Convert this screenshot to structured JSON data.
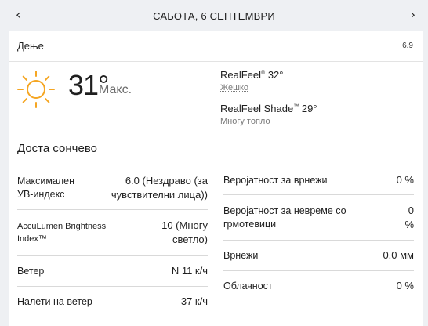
{
  "nav": {
    "prev_icon": "‹",
    "next_icon": "›",
    "date": "САБОТА, 6 СЕПТЕМВРИ"
  },
  "header": {
    "title": "Дење",
    "timestamp": "6.9"
  },
  "current": {
    "icon": "sun-icon",
    "temperature": "31°",
    "unit_label": "Макс.",
    "realfeel_label": "RealFeel",
    "realfeel_value": "32°",
    "realfeel_desc": "Жешко",
    "realfeel_shade_label": "RealFeel Shade",
    "realfeel_shade_value": "29°",
    "realfeel_shade_desc": "Многу топло",
    "summary": "Доста сончево"
  },
  "details_left": [
    {
      "label": "Максимален УВ-индекс",
      "value": "6.0 (Нездраво (за чувствителни лица))"
    },
    {
      "label": "AccuLumen Brightness Index™",
      "value": "10 (Многу светло)"
    },
    {
      "label": "Ветер",
      "value": "N 11 к/ч"
    },
    {
      "label": "Налети на ветер",
      "value": "37 к/ч"
    }
  ],
  "details_right": [
    {
      "label": "Веројатност за врнежи",
      "value": "0 %"
    },
    {
      "label": "Веројатност за невреме со грмотевици",
      "value": "0 %"
    },
    {
      "label": "Врнежи",
      "value": "0.0 мм"
    },
    {
      "label": "Облачност",
      "value": "0 %"
    }
  ],
  "colors": {
    "sun": "#f5a623",
    "background": "#eef0f3",
    "card": "#ffffff"
  }
}
